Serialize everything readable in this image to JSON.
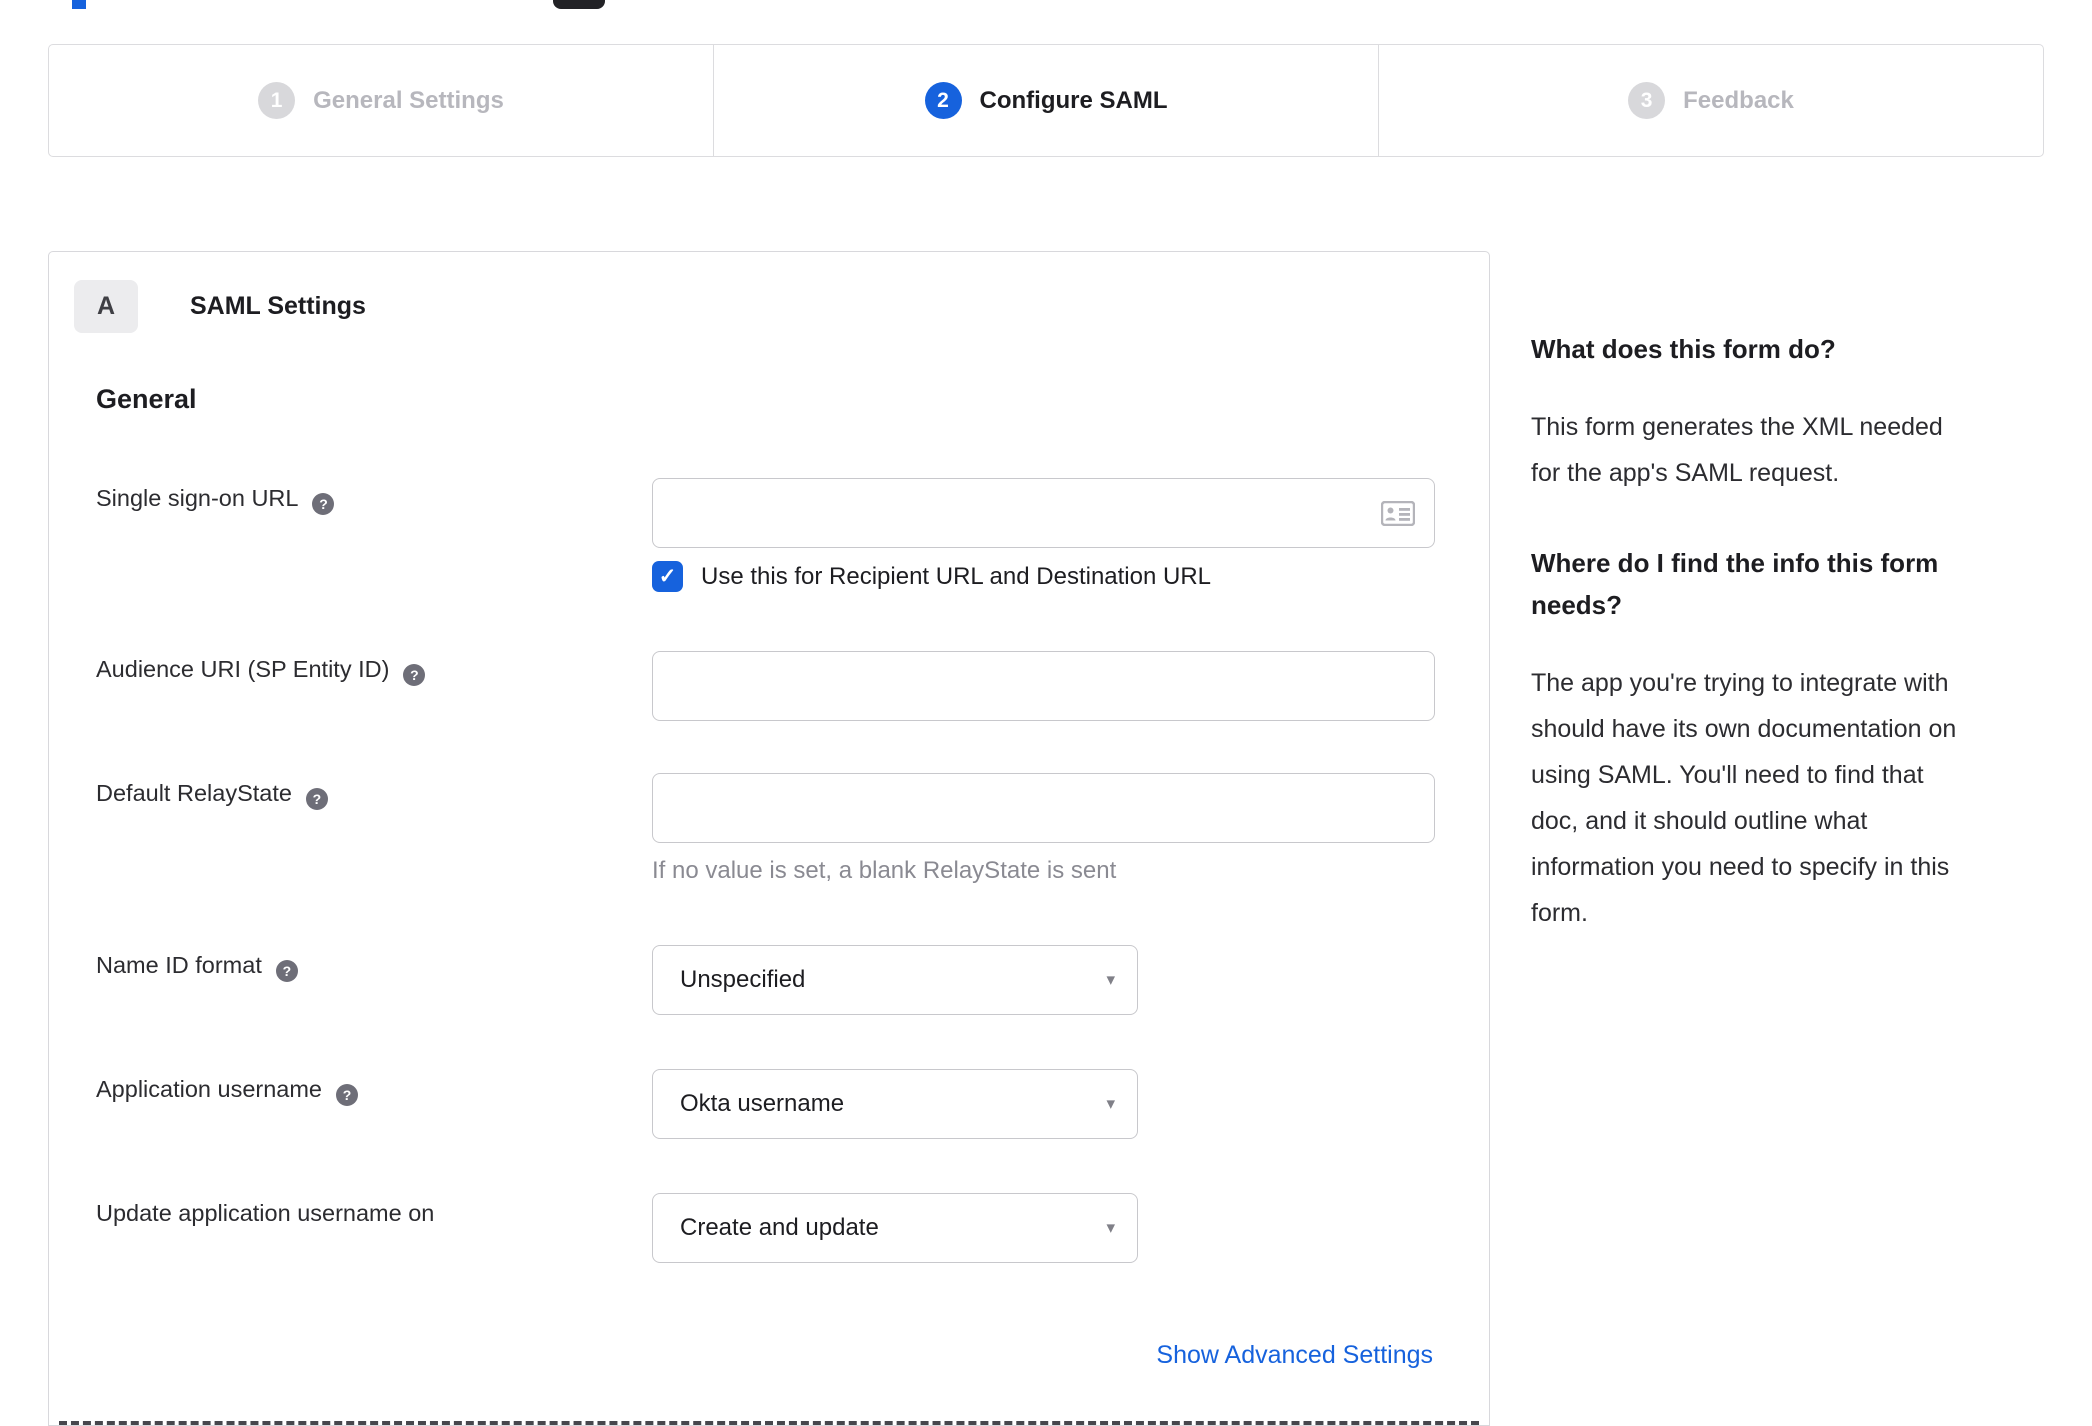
{
  "stepper": {
    "steps": [
      {
        "number": "1",
        "label": "General Settings",
        "state": "inactive"
      },
      {
        "number": "2",
        "label": "Configure SAML",
        "state": "active"
      },
      {
        "number": "3",
        "label": "Feedback",
        "state": "inactive"
      }
    ]
  },
  "saml_card": {
    "section_badge": "A",
    "section_title": "SAML Settings",
    "group_title": "General",
    "fields": [
      {
        "label": "Single sign-on URL",
        "type": "text",
        "value": "",
        "checkbox_checked": true,
        "checkbox_label": "Use this for Recipient URL and Destination URL"
      },
      {
        "label": "Audience URI (SP Entity ID)",
        "type": "text",
        "value": ""
      },
      {
        "label": "Default RelayState",
        "type": "text",
        "value": "",
        "helper": "If no value is set, a blank RelayState is sent"
      },
      {
        "label": "Name ID format",
        "type": "select",
        "value": "Unspecified"
      },
      {
        "label": "Application username",
        "type": "select",
        "value": "Okta username"
      },
      {
        "label": "Update application username on",
        "type": "select",
        "value": "Create and update"
      }
    ],
    "advanced_link": "Show Advanced Settings"
  },
  "help_panel": {
    "sections": [
      {
        "title": "What does this form do?",
        "body": "This form generates the XML needed\nfor the app's SAML request."
      },
      {
        "title": "Where do I find the info this form\nneeds?",
        "body": "The app you're trying to integrate with\nshould have its own documentation on\nusing SAML. You'll need to find that\ndoc, and it should outline what\ninformation you need to specify in this\nform."
      }
    ]
  },
  "icons": {
    "help": "?",
    "check": "✓",
    "caret": "▾"
  },
  "colors": {
    "accent_blue": "#1662dd",
    "inactive_gray": "#b7b7bd",
    "text_dark": "#1d1d21",
    "border_gray": "#d8d8dc"
  }
}
